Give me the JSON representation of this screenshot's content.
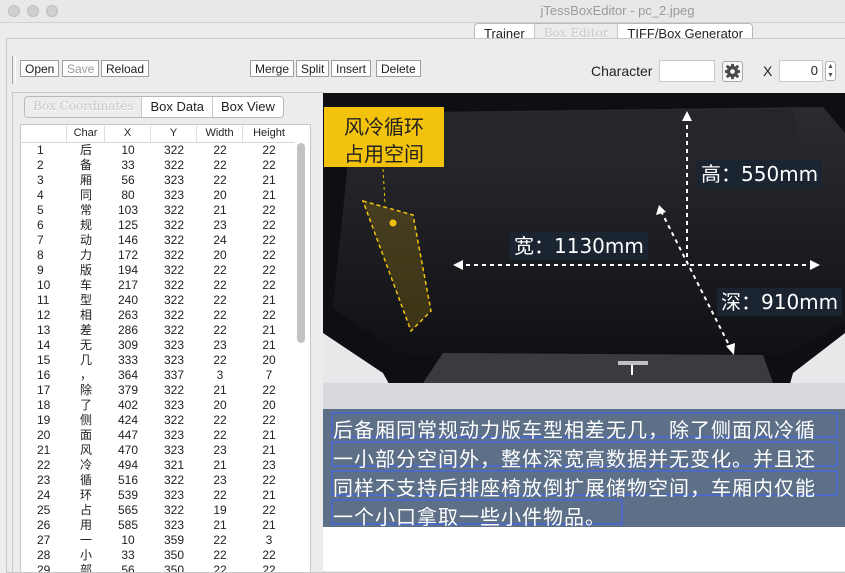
{
  "window": {
    "title": "jTessBoxEditor - pc_2.jpeg"
  },
  "main_tabs": [
    {
      "label": "Trainer",
      "active": false
    },
    {
      "label": "Box Editor",
      "active": true
    },
    {
      "label": "TIFF/Box Generator",
      "active": false
    }
  ],
  "toolbar": {
    "open": "Open",
    "save": "Save",
    "reload": "Reload",
    "merge": "Merge",
    "split": "Split",
    "insert": "Insert",
    "delete": "Delete",
    "character_label": "Character",
    "character_value": "",
    "x_label": "X",
    "x_value": "0"
  },
  "sub_tabs": [
    {
      "label": "Box Coordinates",
      "active": true
    },
    {
      "label": "Box Data",
      "active": false
    },
    {
      "label": "Box View",
      "active": false
    }
  ],
  "table": {
    "columns": [
      "",
      "Char",
      "X",
      "Y",
      "Width",
      "Height"
    ],
    "rows": [
      [
        "1",
        "后",
        "10",
        "322",
        "22",
        "22"
      ],
      [
        "2",
        "备",
        "33",
        "322",
        "22",
        "22"
      ],
      [
        "3",
        "厢",
        "56",
        "323",
        "22",
        "21"
      ],
      [
        "4",
        "同",
        "80",
        "323",
        "20",
        "21"
      ],
      [
        "5",
        "常",
        "103",
        "322",
        "21",
        "22"
      ],
      [
        "6",
        "规",
        "125",
        "322",
        "23",
        "22"
      ],
      [
        "7",
        "动",
        "146",
        "322",
        "24",
        "22"
      ],
      [
        "8",
        "力",
        "172",
        "322",
        "20",
        "22"
      ],
      [
        "9",
        "版",
        "194",
        "322",
        "22",
        "22"
      ],
      [
        "10",
        "车",
        "217",
        "322",
        "22",
        "22"
      ],
      [
        "11",
        "型",
        "240",
        "322",
        "22",
        "21"
      ],
      [
        "12",
        "相",
        "263",
        "322",
        "22",
        "22"
      ],
      [
        "13",
        "差",
        "286",
        "322",
        "22",
        "21"
      ],
      [
        "14",
        "无",
        "309",
        "323",
        "23",
        "21"
      ],
      [
        "15",
        "几",
        "333",
        "323",
        "22",
        "20"
      ],
      [
        "16",
        "，",
        "364",
        "337",
        "3",
        "7"
      ],
      [
        "17",
        "除",
        "379",
        "322",
        "21",
        "22"
      ],
      [
        "18",
        "了",
        "402",
        "323",
        "20",
        "20"
      ],
      [
        "19",
        "侧",
        "424",
        "322",
        "22",
        "22"
      ],
      [
        "20",
        "面",
        "447",
        "323",
        "22",
        "21"
      ],
      [
        "21",
        "风",
        "470",
        "323",
        "23",
        "21"
      ],
      [
        "22",
        "冷",
        "494",
        "321",
        "21",
        "23"
      ],
      [
        "23",
        "循",
        "516",
        "322",
        "23",
        "22"
      ],
      [
        "24",
        "环",
        "539",
        "323",
        "22",
        "21"
      ],
      [
        "25",
        "占",
        "565",
        "322",
        "19",
        "22"
      ],
      [
        "26",
        "用",
        "585",
        "323",
        "21",
        "21"
      ],
      [
        "27",
        "一",
        "10",
        "359",
        "22",
        "3"
      ],
      [
        "28",
        "小",
        "33",
        "350",
        "22",
        "22"
      ],
      [
        "29",
        "部",
        "56",
        "350",
        "22",
        "22"
      ]
    ]
  },
  "image": {
    "tag_line1": "风冷循环",
    "tag_line2": "占用空间",
    "height_label": "高：550mm",
    "width_label": "宽：1130mm",
    "depth_label": "深：910mm",
    "caption_lines": [
      "后备厢同常规动力版车型相差无几，除了侧面风冷循",
      "一小部分空间外，整体深宽高数据并无变化。并且还",
      "同样不支持后排座椅放倒扩展储物空间，车厢内仅能",
      "一个小口拿取一些小件物品。"
    ]
  },
  "colors": {
    "tag_yellow": "#f2c20c",
    "caption_bg": "#5d7088",
    "box_outline": "#3a63ff"
  }
}
